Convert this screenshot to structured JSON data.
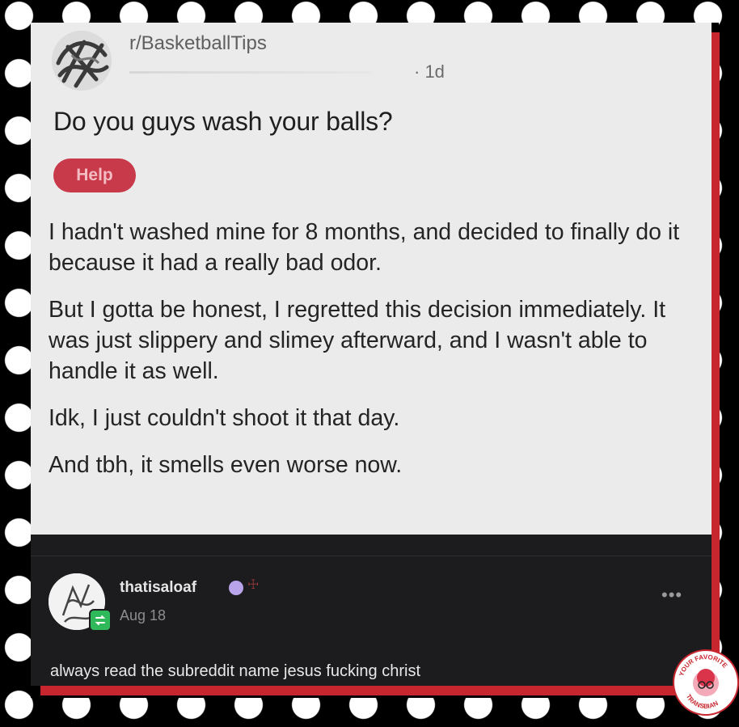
{
  "post": {
    "subreddit": "r/BasketballTips",
    "author_redacted": "——",
    "age": "· 1d",
    "title": "Do you guys wash your balls?",
    "flair": "Help",
    "paragraphs": [
      "I hadn't washed mine for 8 months, and decided to finally do it because it had a really bad odor.",
      "But I gotta be honest, I regretted this decision immediately. It was just slippery and slimey afterward, and I wasn't able to handle it as well.",
      "Idk, I just couldn't shoot it that day.",
      "And tbh, it smells even worse now."
    ]
  },
  "comment": {
    "username": "thatisaloaf",
    "date": "Aug 18",
    "more": "•••",
    "text": "always read the subreddit name jesus fucking christ"
  },
  "watermark": {
    "text": "YOUR FAVORITE TRANSBIAN"
  },
  "colors": {
    "flair_bg": "#c8394a",
    "accent_red": "#c8262e",
    "card_bg": "#ebebeb",
    "comment_bg": "#1c1c1e"
  }
}
